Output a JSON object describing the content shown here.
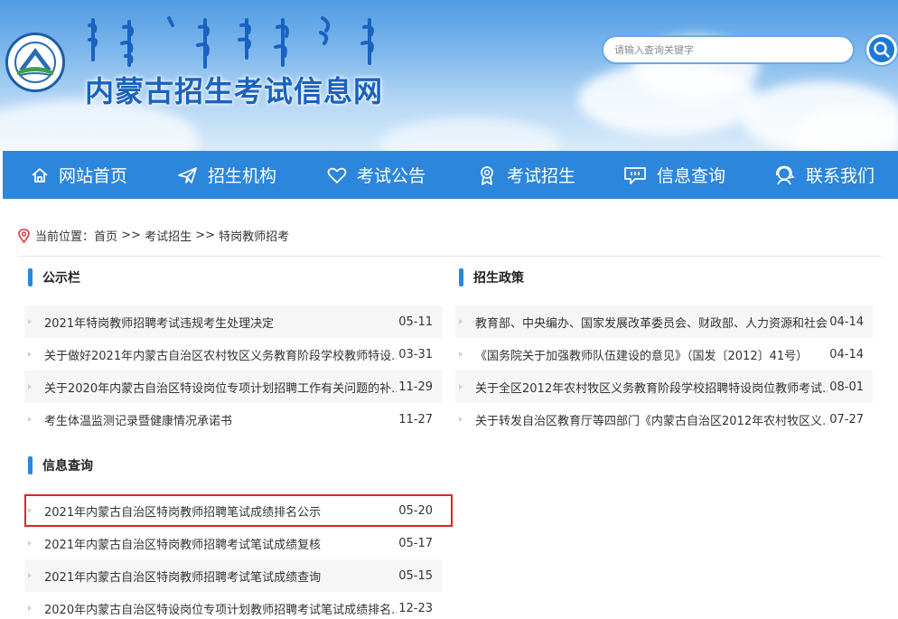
{
  "header": {
    "site_title": "内蒙古招生考试信息网",
    "search_placeholder": "请输入查询关键字"
  },
  "nav": [
    {
      "label": "网站首页",
      "icon": "home-icon"
    },
    {
      "label": "招生机构",
      "icon": "paper-plane-icon"
    },
    {
      "label": "考试公告",
      "icon": "heart-icon"
    },
    {
      "label": "考试招生",
      "icon": "award-icon"
    },
    {
      "label": "信息查询",
      "icon": "chat-icon"
    },
    {
      "label": "联系我们",
      "icon": "support-icon"
    }
  ],
  "breadcrumb": {
    "prefix": "当前位置：",
    "home": "首页",
    "sep1": " >> ",
    "level2": "考试招生",
    "sep2": " >> ",
    "level3": "特岗教师招考"
  },
  "notice": {
    "title": "公示栏",
    "items": [
      {
        "title": "2021年特岗教师招聘考试违规考生处理决定",
        "date": "05-11"
      },
      {
        "title": "关于做好2021年内蒙古自治区农村牧区义务教育阶段学校教师特设...",
        "date": "03-31"
      },
      {
        "title": "关于2020年内蒙古自治区特设岗位专项计划招聘工作有关问题的补...",
        "date": "11-29"
      },
      {
        "title": "考生体温监测记录暨健康情况承诺书",
        "date": "11-27"
      }
    ]
  },
  "policy": {
    "title": "招生政策",
    "items": [
      {
        "title": "教育部、中央编办、国家发展改革委员会、财政部、人力资源和社会...",
        "date": "04-14"
      },
      {
        "title": "《国务院关于加强教师队伍建设的意见》（国发〔2012〕41号）",
        "date": "04-14"
      },
      {
        "title": "关于全区2012年农村牧区义务教育阶段学校招聘特设岗位教师考试...",
        "date": "08-01"
      },
      {
        "title": "关于转发自治区教育厅等四部门《内蒙古自治区2012年农村牧区义...",
        "date": "07-27"
      }
    ]
  },
  "query": {
    "title": "信息查询",
    "items": [
      {
        "title": "2021年内蒙古自治区特岗教师招聘笔试成绩排名公示",
        "date": "05-20"
      },
      {
        "title": "2021年内蒙古自治区特岗教师招聘考试笔试成绩复核",
        "date": "05-17"
      },
      {
        "title": "2021年内蒙古自治区特岗教师招聘考试笔试成绩查询",
        "date": "05-15"
      },
      {
        "title": "2020年内蒙古自治区特设岗位专项计划教师招聘考试笔试成绩排名...",
        "date": "12-23"
      }
    ]
  },
  "colors": {
    "nav_bg": "#2c86dc",
    "title_blue": "#1a62bf",
    "highlight_border": "#d9262b"
  }
}
